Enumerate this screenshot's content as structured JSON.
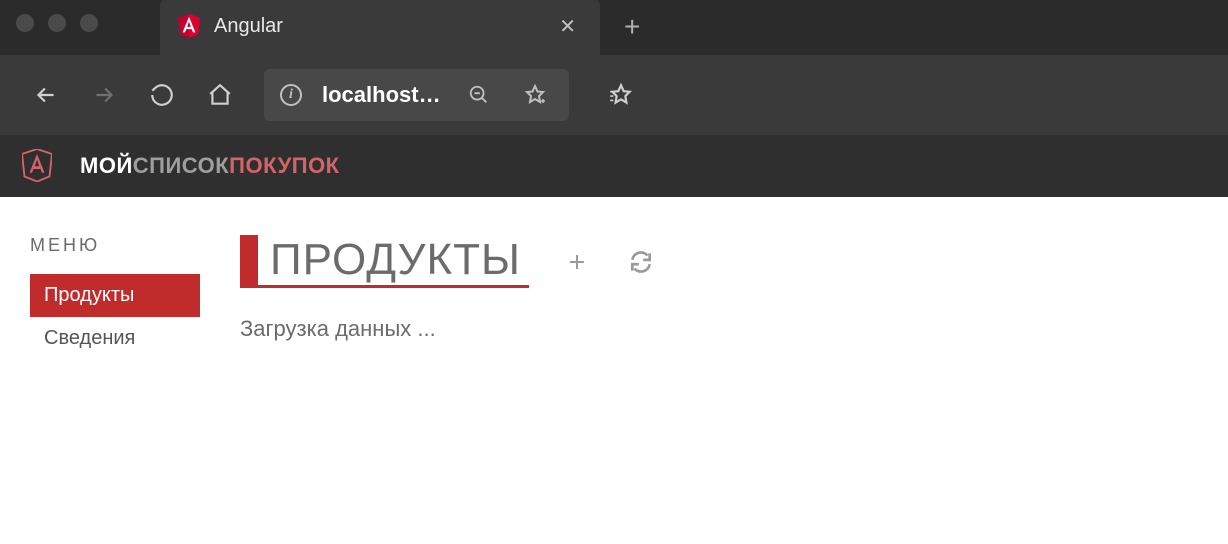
{
  "browser": {
    "tab_title": "Angular",
    "address": "localhost…"
  },
  "app": {
    "title_part1": "МОЙ",
    "title_part2": "СПИСОК",
    "title_part3": "ПОКУПОК"
  },
  "sidebar": {
    "menu_label": "МЕНЮ",
    "items": [
      {
        "label": "Продукты",
        "active": true
      },
      {
        "label": "Сведения",
        "active": false
      }
    ]
  },
  "main": {
    "page_title": "ПРОДУКТЫ",
    "loading_text": "Загрузка данных ..."
  },
  "colors": {
    "accent": "#c02b2b",
    "dark_bg": "#2f2f2f"
  }
}
